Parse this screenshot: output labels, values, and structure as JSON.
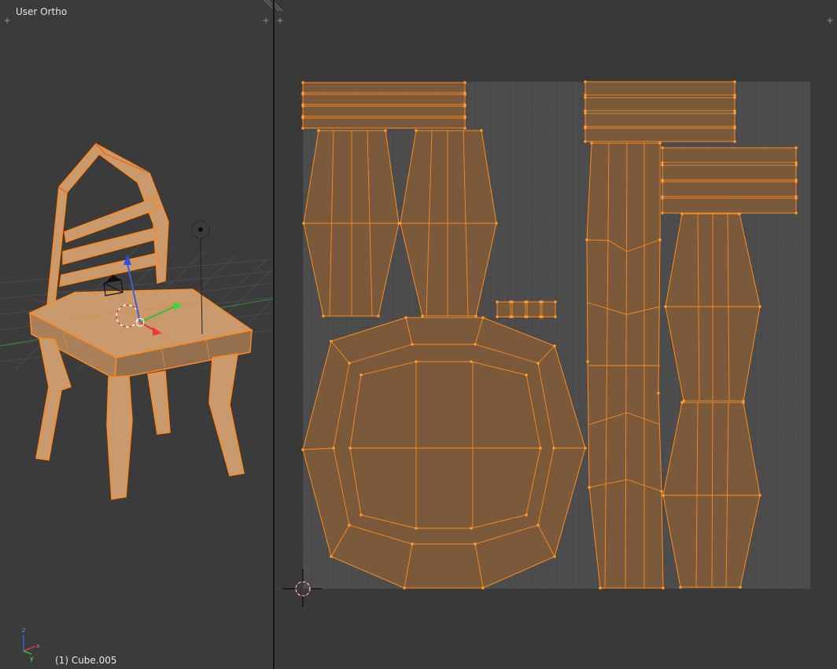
{
  "viewport3d": {
    "view_label": "User Ortho",
    "object_label": "(1) Cube.005",
    "axes": {
      "x": "x",
      "y": "y",
      "z": "z"
    }
  },
  "uv_editor": {
    "grid_background": "#4d4d4d",
    "island_fill": "#7a5a3a",
    "edge_color": "#ff8a1e"
  },
  "icons": {
    "area_corner": "plus",
    "area_split": "hatch-lines",
    "cursor": "2d-cursor",
    "lamp": "lamp-icon",
    "camera": "camera-icon"
  },
  "colors": {
    "selection_orange": "#ff8a1e",
    "grid_floor": "#4b4b4b",
    "x_axis": "#d83a3a",
    "y_axis": "#3ab83a",
    "z_axis": "#3a5fd8"
  }
}
